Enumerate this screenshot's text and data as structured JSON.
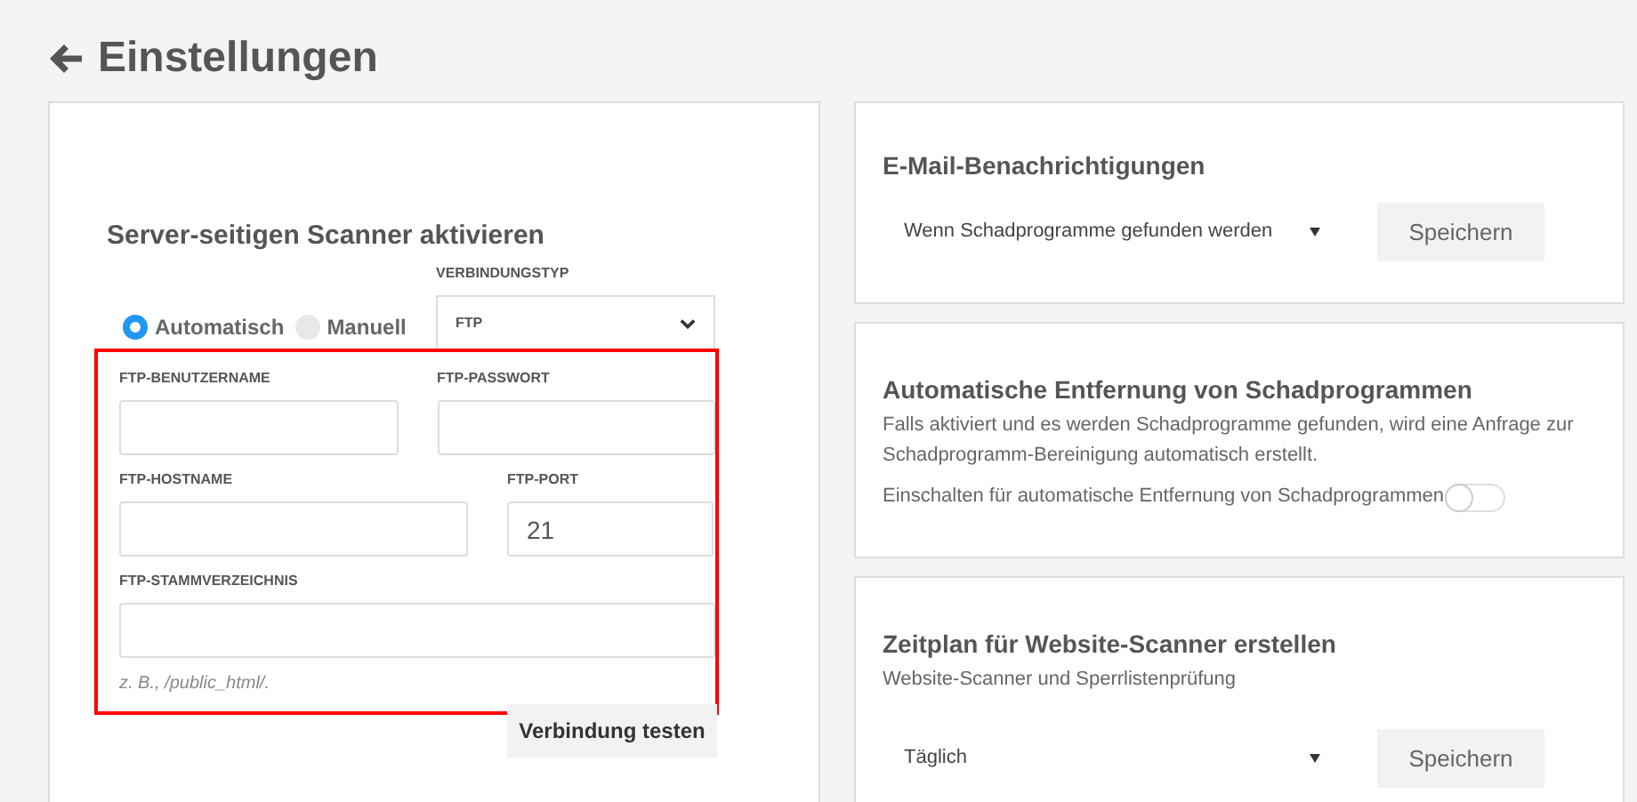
{
  "page": {
    "title": "Einstellungen"
  },
  "scanner": {
    "title": "Server-seitigen Scanner aktivieren",
    "modes": [
      {
        "label": "Automatisch",
        "selected": true
      },
      {
        "label": "Manuell",
        "selected": false
      }
    ],
    "connection_type": {
      "label": "VERBINDUNGSTYP",
      "value": "FTP"
    },
    "field_rows": [
      [
        {
          "label": "FTP-BENUTZERNAME"
        },
        {
          "label": "FTP-PASSWORT"
        }
      ],
      [
        {
          "label": "FTP-HOSTNAME"
        },
        {
          "label": "FTP-PORT",
          "value": "21"
        }
      ],
      [
        {
          "label": "FTP-STAMMVERZEICHNIS"
        }
      ]
    ],
    "hint": "z. B., /public_html/.",
    "button": "Verbindung testen"
  },
  "email": {
    "title": "E-Mail-Benachrichtigungen",
    "select": "Wenn Schadprogramme gefunden werden",
    "button": "Speichern"
  },
  "removal": {
    "title": "Automatische Entfernung von Schadprogrammen",
    "description": "Falls aktiviert und es werden Schadprogramme gefunden, wird eine Anfrage zur Schadprogramm-Bereinigung automatisch erstellt.",
    "toggle": {
      "label": "Einschalten für automatische Entfernung von Schadprogrammen",
      "on": false
    }
  },
  "schedule": {
    "title": "Zeitplan für Website-Scanner erstellen",
    "subtitle": "Website-Scanner und Sperrlistenprüfung",
    "select": "Täglich",
    "button": "Speichern"
  }
}
